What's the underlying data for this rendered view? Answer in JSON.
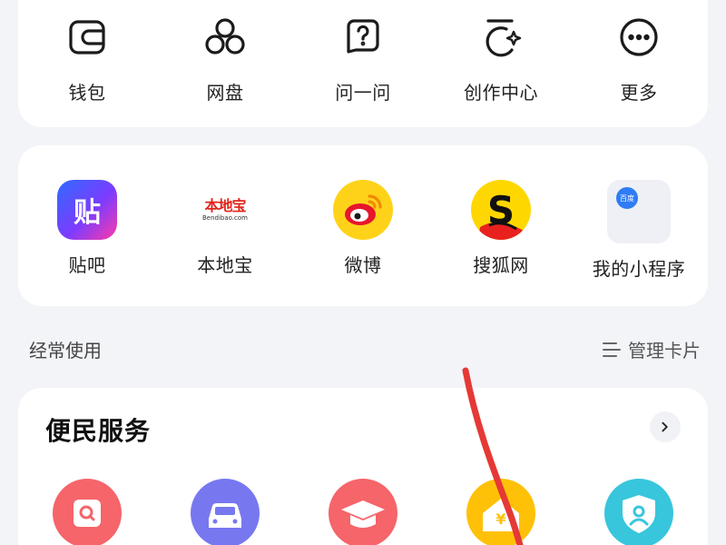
{
  "tools": [
    {
      "icon": "wallet-icon",
      "label": "钱包"
    },
    {
      "icon": "cloud-drive-icon",
      "label": "网盘"
    },
    {
      "icon": "ask-icon",
      "label": "问一问"
    },
    {
      "icon": "creation-center-icon",
      "label": "创作中心"
    },
    {
      "icon": "more-icon",
      "label": "更多"
    }
  ],
  "apps": [
    {
      "icon": "tieba-icon",
      "label": "贴吧",
      "glyph": "贴"
    },
    {
      "icon": "bendibao-icon",
      "label": "本地宝",
      "logo_text": "本地宝",
      "logo_sub": "Bendibao.com"
    },
    {
      "icon": "weibo-icon",
      "label": "微博"
    },
    {
      "icon": "sohu-icon",
      "label": "搜狐网",
      "glyph": "S"
    },
    {
      "icon": "mini-program-icon",
      "label": "我的小程序",
      "badge": "百度"
    }
  ],
  "section": {
    "title": "经常使用",
    "manage_label": "管理卡片"
  },
  "services": {
    "title": "便民服务",
    "items": [
      {
        "icon": "search-service-icon",
        "color": "#f5656a"
      },
      {
        "icon": "car-icon",
        "color": "#7778f0"
      },
      {
        "icon": "graduation-cap-icon",
        "color": "#f5656a"
      },
      {
        "icon": "housing-fund-icon",
        "color": "#ffc107"
      },
      {
        "icon": "user-shield-icon",
        "color": "#38c6dc"
      }
    ]
  },
  "colors": {
    "background": "#f3f4f8",
    "card": "#ffffff",
    "annotation_stroke": "#e53935"
  }
}
